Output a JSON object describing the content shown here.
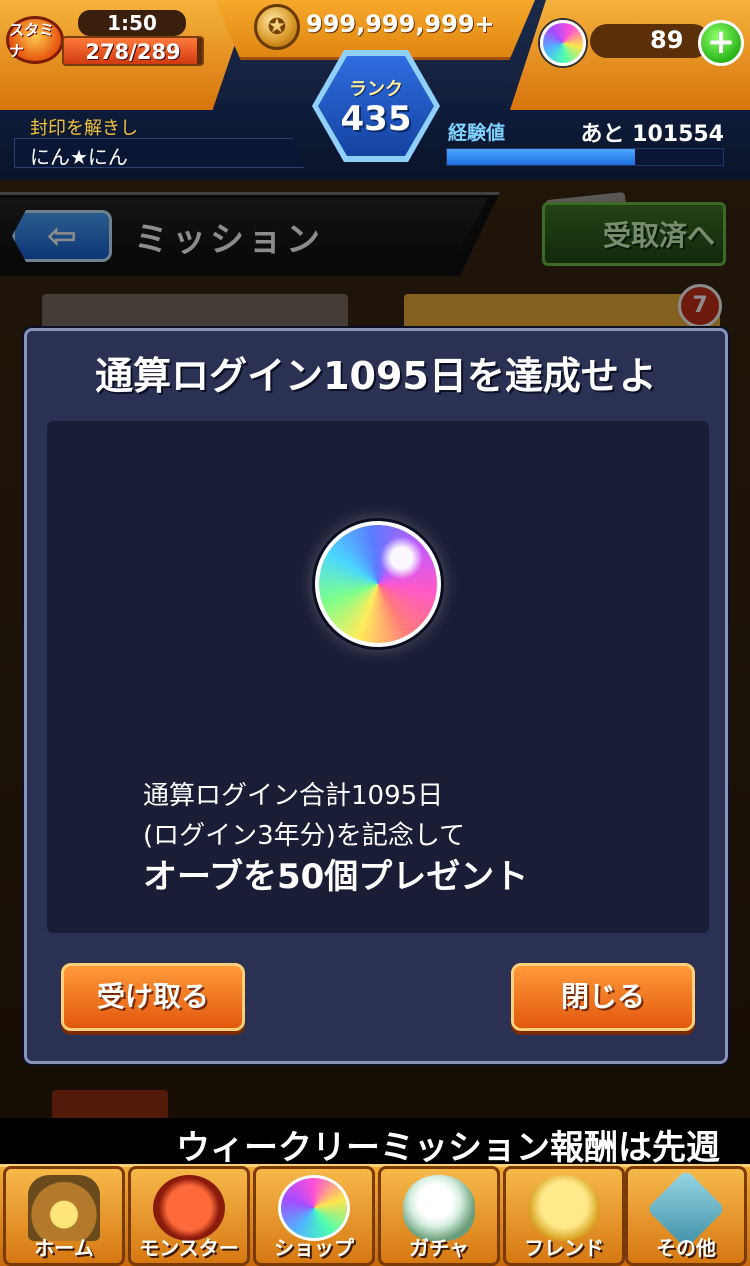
{
  "status": {
    "stamina_icon_label": "スタミナ",
    "stamina_timer": "1:50",
    "stamina_current_max": "278/289",
    "stamina_fraction": 0.962,
    "coins": "999,999,999+",
    "orb_count": "89",
    "rank_label": "ランク",
    "rank_value": "435",
    "title_sub": "封印を解きし",
    "user_name": "にん★にん",
    "exp_label": "経験値",
    "exp_remaining": "あと 101554",
    "exp_fraction": 0.68
  },
  "mission_screen": {
    "title": "ミッション",
    "back_glyph": "⇦",
    "received_button": "受取済へ",
    "tab_badge": "7"
  },
  "modal": {
    "title": "通算ログイン1095日を達成せよ",
    "reward_line1": "通算ログイン合計1095日",
    "reward_line2": "(ログイン3年分)を記念して",
    "reward_line3": "オーブを50個プレゼント",
    "receive_button": "受け取る",
    "close_button": "閉じる"
  },
  "ticker": {
    "text": "ウィークリーミッション報酬は先週"
  },
  "bottom_nav": [
    {
      "label": "ホーム",
      "icon": "home-icon"
    },
    {
      "label": "モンスター",
      "icon": "monster-icon"
    },
    {
      "label": "ショップ",
      "icon": "shop-icon"
    },
    {
      "label": "ガチャ",
      "icon": "gacha-icon"
    },
    {
      "label": "フレンド",
      "icon": "friend-icon"
    },
    {
      "label": "その他",
      "icon": "other-icon"
    }
  ],
  "colors": {
    "accent_orange": "#e2580e",
    "modal_bg": "#2a3152",
    "rank_blue": "#1542a0",
    "exp_blue": "#1f6ee0"
  }
}
